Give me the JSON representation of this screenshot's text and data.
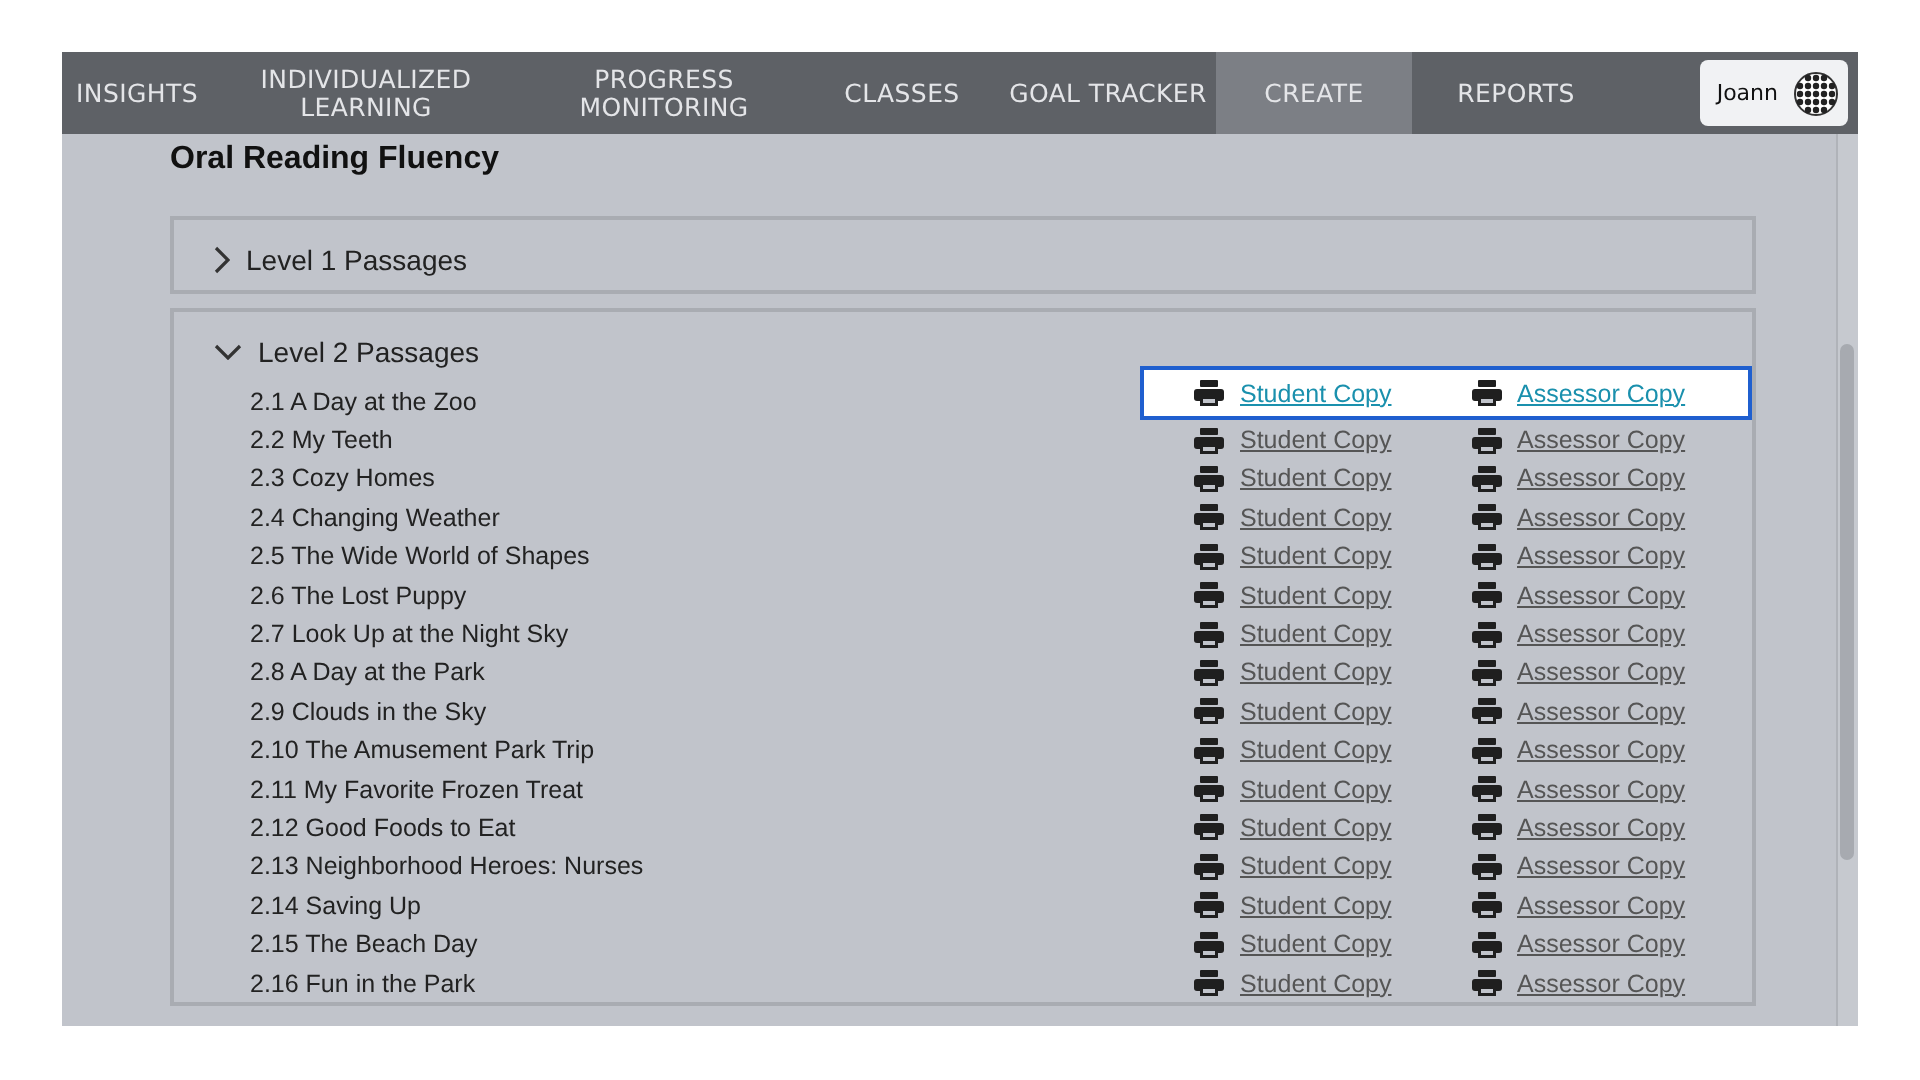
{
  "nav": {
    "items": [
      {
        "label": "INSIGHTS",
        "selected": false
      },
      {
        "label": "INDIVIDUALIZED LEARNING",
        "selected": false
      },
      {
        "label": "PROGRESS MONITORING",
        "selected": false
      },
      {
        "label": "CLASSES",
        "selected": false
      },
      {
        "label": "GOAL TRACKER",
        "selected": false
      },
      {
        "label": "CREATE",
        "selected": true
      },
      {
        "label": "REPORTS",
        "selected": false
      }
    ],
    "user": {
      "name": "Joann"
    }
  },
  "page_title": "Oral Reading Fluency",
  "panels": [
    {
      "title": "Level 1 Passages",
      "expanded": false
    },
    {
      "title": "Level 2 Passages",
      "expanded": true,
      "passages": [
        {
          "title": "2.1 A Day at the Zoo",
          "student_link": "Student Copy",
          "assessor_link": "Assessor Copy",
          "selected": true
        },
        {
          "title": "2.2 My Teeth",
          "student_link": "Student Copy",
          "assessor_link": "Assessor Copy",
          "selected": false
        },
        {
          "title": "2.3 Cozy Homes",
          "student_link": "Student Copy",
          "assessor_link": "Assessor Copy",
          "selected": false
        },
        {
          "title": "2.4 Changing Weather",
          "student_link": "Student Copy",
          "assessor_link": "Assessor Copy",
          "selected": false
        },
        {
          "title": "2.5 The Wide World of Shapes",
          "student_link": "Student Copy",
          "assessor_link": "Assessor Copy",
          "selected": false
        },
        {
          "title": "2.6 The Lost Puppy",
          "student_link": "Student Copy",
          "assessor_link": "Assessor Copy",
          "selected": false
        },
        {
          "title": "2.7 Look Up at the Night Sky",
          "student_link": "Student Copy",
          "assessor_link": "Assessor Copy",
          "selected": false
        },
        {
          "title": "2.8 A Day at the Park",
          "student_link": "Student Copy",
          "assessor_link": "Assessor Copy",
          "selected": false
        },
        {
          "title": "2.9 Clouds in the Sky",
          "student_link": "Student Copy",
          "assessor_link": "Assessor Copy",
          "selected": false
        },
        {
          "title": "2.10 The Amusement Park Trip",
          "student_link": "Student Copy",
          "assessor_link": "Assessor Copy",
          "selected": false
        },
        {
          "title": "2.11 My Favorite Frozen Treat",
          "student_link": "Student Copy",
          "assessor_link": "Assessor Copy",
          "selected": false
        },
        {
          "title": "2.12 Good Foods to Eat",
          "student_link": "Student Copy",
          "assessor_link": "Assessor Copy",
          "selected": false
        },
        {
          "title": "2.13 Neighborhood Heroes: Nurses",
          "student_link": "Student Copy",
          "assessor_link": "Assessor Copy",
          "selected": false
        },
        {
          "title": "2.14 Saving Up",
          "student_link": "Student Copy",
          "assessor_link": "Assessor Copy",
          "selected": false
        },
        {
          "title": "2.15 The Beach Day",
          "student_link": "Student Copy",
          "assessor_link": "Assessor Copy",
          "selected": false
        },
        {
          "title": "2.16 Fun in the Park",
          "student_link": "Student Copy",
          "assessor_link": "Assessor Copy",
          "selected": false
        }
      ]
    }
  ]
}
